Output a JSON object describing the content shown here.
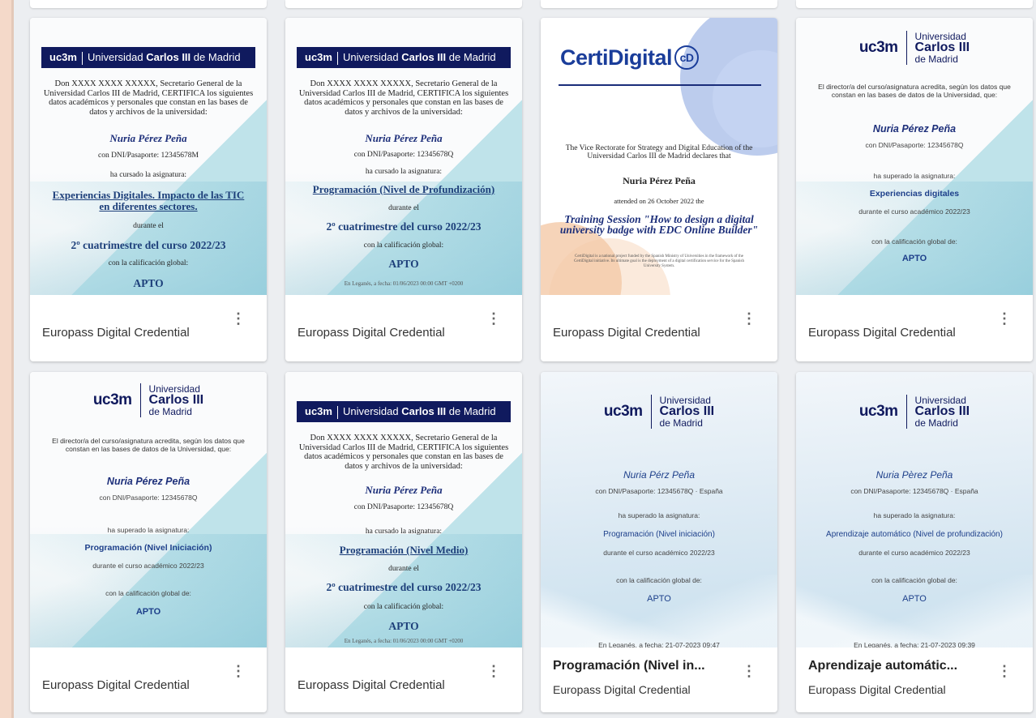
{
  "cards": [
    {
      "id": "c1",
      "thumbnail": {
        "banner": {
          "brand": "uc3m",
          "university": "Universidad",
          "name_bold": "Carlos III",
          "suffix": "de Madrid"
        },
        "intro": "Don XXXX XXXX XXXXX, Secretario General de la Universidad Carlos III de Madrid, CERTIFICA los siguientes datos académicos y personales que constan en las bases de datos y archivos de la universidad:",
        "holder": "Nuria Pérez Peña",
        "id_line": "con DNI/Pasaporte: 12345678M",
        "course_intro": "ha cursado la asignatura:",
        "subject": "Experiencias Digitales. Impacto de las TIC en diferentes sectores.",
        "period_intro": "durante el",
        "period": "2º cuatrimestre del curso 2022/23",
        "grade_intro": "con la calificación global:",
        "grade": "APTO"
      },
      "title": "",
      "subtitle": "Europass Digital Credential"
    },
    {
      "id": "c2",
      "thumbnail": {
        "banner": {
          "brand": "uc3m",
          "university": "Universidad",
          "name_bold": "Carlos III",
          "suffix": "de Madrid"
        },
        "intro": "Don XXXX XXXX XXXXX, Secretario General de la Universidad Carlos III de Madrid, CERTIFICA los siguientes datos académicos y personales que constan en las bases de datos y archivos de la universidad:",
        "holder": "Nuria Pérez Peña",
        "id_line": "con DNI/Pasaporte: 12345678Q",
        "course_intro": "ha cursado la asignatura:",
        "subject": "Programación (Nivel de Profundización)",
        "period_intro": "durante el",
        "period": "2º cuatrimestre del curso 2022/23",
        "grade_intro": "con la calificación global:",
        "grade": "APTO",
        "footer": "En Leganés, a fecha: 01/06/2023 00:00 GMT +0200"
      },
      "title": "",
      "subtitle": "Europass Digital Credential"
    },
    {
      "id": "c3",
      "thumbnail": {
        "brand": "CertiDigital",
        "brand_badge": "cD",
        "intro": "The Vice Rectorate for Strategy and Digital Education of the Universidad Carlos III de Madrid declares that",
        "holder": "Nuria Pérez Peña",
        "attended": "attended on 26 October 2022 the",
        "course": "Training Session \"How to design a digital university badge with EDC Online Builder\"",
        "fineprint": "CertiDigital is a national project funded by the Spanish Ministry of Universities in the framework of the CertiDigital initiative. Its ultimate goal is the deployment of a digital certification service for the Spanish University System."
      },
      "title": "",
      "subtitle": "Europass Digital Credential"
    },
    {
      "id": "c4",
      "thumbnail": {
        "logo": {
          "brand": "uc3m",
          "l1": "Universidad",
          "l2": "Carlos III",
          "l3": "de Madrid"
        },
        "intro": "El director/a del curso/asignatura acredita, según los datos que constan en las bases de datos de la Universidad, que:",
        "holder": "Nuria Pérez Peña",
        "id_line": "con DNI/Pasaporte: 12345678Q",
        "course_intro": "ha superado la asignatura:",
        "subject": "Experiencias digitales",
        "period": "durante el curso académico 2022/23",
        "grade_intro": "con la calificación global de:",
        "grade": "APTO"
      },
      "title": "",
      "subtitle": "Europass Digital Credential"
    },
    {
      "id": "c5",
      "thumbnail": {
        "logo": {
          "brand": "uc3m",
          "l1": "Universidad",
          "l2": "Carlos III",
          "l3": "de Madrid"
        },
        "intro": "El director/a del curso/asignatura acredita, según los datos que constan en las bases de datos de la Universidad, que:",
        "holder": "Nuria Pérez Peña",
        "id_line": "con DNI/Pasaporte: 12345678Q",
        "course_intro": "ha superado la asignatura:",
        "subject": "Programación (Nivel Iniciación)",
        "period": "durante el curso académico 2022/23",
        "grade_intro": "con la calificación global de:",
        "grade": "APTO"
      },
      "title": "",
      "subtitle": "Europass Digital Credential"
    },
    {
      "id": "c6",
      "thumbnail": {
        "banner": {
          "brand": "uc3m",
          "university": "Universidad",
          "name_bold": "Carlos III",
          "suffix": "de Madrid"
        },
        "intro": "Don XXXX XXXX XXXXX, Secretario General de la Universidad Carlos III de Madrid, CERTIFICA los siguientes datos académicos y personales que constan en las bases de datos y archivos de la universidad:",
        "holder": "Nuria Pérez Peña",
        "id_line": "con DNI/Pasaporte: 12345678Q",
        "course_intro": "ha cursado la asignatura:",
        "subject": "Programación (Nivel Medio)",
        "period_intro": "durante el",
        "period": "2º cuatrimestre del curso 2022/23",
        "grade_intro": "con la calificación global:",
        "grade": "APTO",
        "footer": "En Leganés, a fecha: 01/06/2023 00:00 GMT +0200"
      },
      "title": "",
      "subtitle": "Europass Digital Credential"
    },
    {
      "id": "c7",
      "thumbnail": {
        "logo": {
          "brand": "uc3m",
          "l1": "Universidad",
          "l2": "Carlos III",
          "l3": "de Madrid"
        },
        "holder": "Nuria Pérz Peña",
        "id_line": "con DNI/Pasaporte: 12345678Q · España",
        "course_intro": "ha superado la asignatura:",
        "subject": "Programación (Nivel iniciación)",
        "period": "durante el curso académico 2022/23",
        "grade_intro": "con la calificación global de:",
        "grade": "APTO",
        "footer": "En Leganés, a fecha: 21-07-2023 09:47"
      },
      "title": "Programación (Nivel in...",
      "subtitle": "Europass Digital Credential"
    },
    {
      "id": "c8",
      "thumbnail": {
        "logo": {
          "brand": "uc3m",
          "l1": "Universidad",
          "l2": "Carlos III",
          "l3": "de Madrid"
        },
        "holder": "Nuria Pèrez Peña",
        "id_line": "con DNI/Pasaporte: 12345678Q · España",
        "course_intro": "ha superado la asignatura:",
        "subject": "Aprendizaje automático (Nivel de profundización)",
        "period": "durante el curso académico 2022/23",
        "grade_intro": "con la calificación global de:",
        "grade": "APTO",
        "footer": "En Leganés, a fecha: 21-07-2023 09:39"
      },
      "title": "Aprendizaje automátic...",
      "subtitle": "Europass Digital Credential"
    }
  ],
  "icons": {
    "more": "more-vert-icon",
    "more_glyph": "⋮"
  },
  "colors": {
    "page_bg": "#f7e7dc",
    "panel_bg": "#eceef1",
    "uc3m_navy": "#101a5e",
    "accent_blue": "#1d3f7a"
  }
}
